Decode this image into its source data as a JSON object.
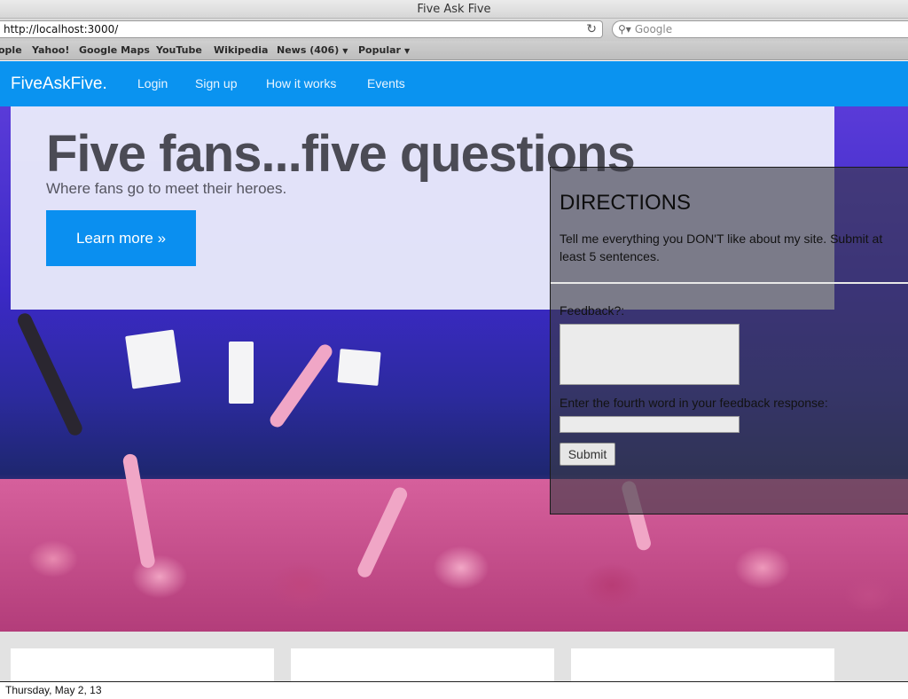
{
  "browser": {
    "window_title": "Five Ask Five",
    "url": "http://localhost:3000/",
    "search_placeholder": "Google",
    "bookmarks": [
      {
        "label": "ople"
      },
      {
        "label": "Yahoo!"
      },
      {
        "label": "Google Maps"
      },
      {
        "label": "YouTube"
      },
      {
        "label": "Wikipedia"
      },
      {
        "label": "News (406)",
        "caret": "▼"
      },
      {
        "label": "Popular",
        "caret": "▼"
      }
    ]
  },
  "nav": {
    "brand": "FiveAskFive.",
    "links": [
      "Login",
      "Sign up",
      "How it works",
      "Events"
    ],
    "color": "#0a93f0"
  },
  "hero": {
    "title": "Five fans...five questions",
    "subtitle": "Where fans go to meet their heroes.",
    "cta": "Learn more »"
  },
  "directions": {
    "title": "DIRECTIONS",
    "text": "Tell me everything you DON'T like about my site. Submit at least 5 sentences.",
    "feedback_label": "Feedback?:",
    "feedback_value": "",
    "fourth_word_label": "Enter the fourth word in your feedback response:",
    "fourth_word_value": "",
    "submit_label": "Submit"
  },
  "footer": {
    "date": "Thursday, May 2, 13"
  }
}
